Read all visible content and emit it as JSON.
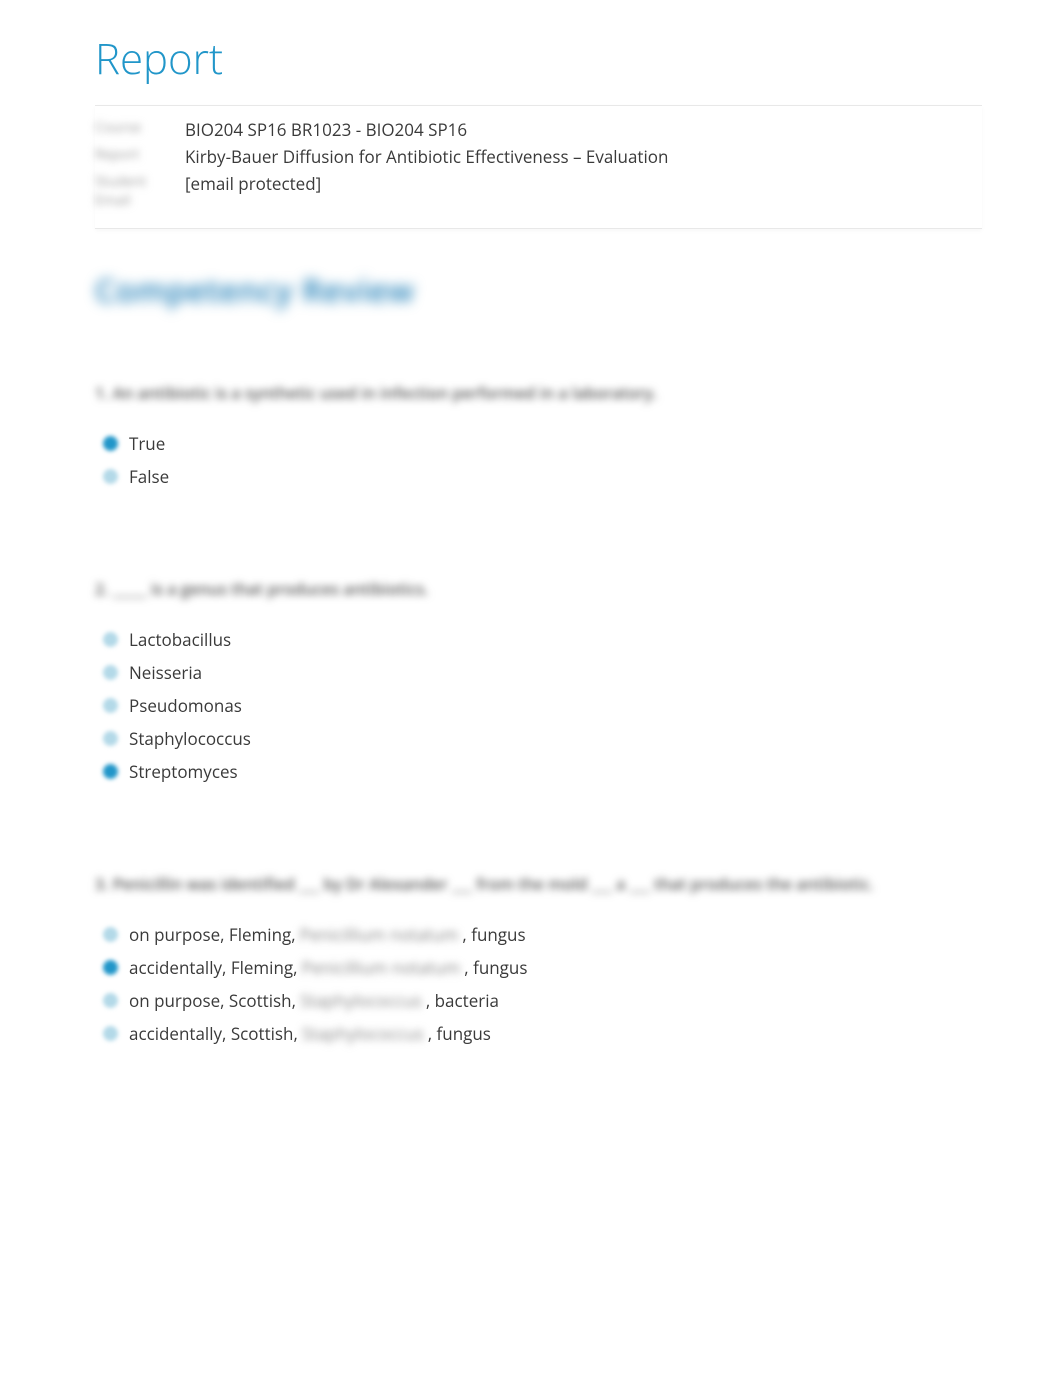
{
  "pageTitle": "Report",
  "header": {
    "labels": {
      "course": "Course",
      "report": "Report",
      "email": "Student Email"
    },
    "course": "BIO204 SP16 BR1023 - BIO204 SP16",
    "report": "Kirby-Bauer Diffusion for Antibiotic Effectiveness – Evaluation",
    "email": "[email protected]"
  },
  "sectionTitle": "Competency Review",
  "questions": [
    {
      "prompt": "1. An antibiotic is a synthetic used in infection performed in a laboratory.",
      "options": [
        {
          "text": "True",
          "selected": true
        },
        {
          "text": "False",
          "selected": false
        }
      ]
    },
    {
      "prompt": "2. _____ is a genus that produces antibiotics.",
      "options": [
        {
          "text": "Lactobacillus",
          "selected": false
        },
        {
          "text": "Neisseria",
          "selected": false
        },
        {
          "text": "Pseudomonas",
          "selected": false
        },
        {
          "text": "Staphylococcus",
          "selected": false
        },
        {
          "text": "Streptomyces",
          "selected": true
        }
      ]
    },
    {
      "prompt": "3. Penicillin was identified ___ by Dr Alexander ___ from the mold ___ a ___ that produces the antibiotic.",
      "options": [
        {
          "parts": [
            "on purpose, Fleming, ",
            "Penicillium notatum",
            " , fungus"
          ],
          "selected": false
        },
        {
          "parts": [
            "accidentally, Fleming, ",
            "Penicillium notatum",
            " , fungus"
          ],
          "selected": true
        },
        {
          "parts": [
            "on purpose, Scottish, ",
            "Staphylococcus",
            " , bacteria"
          ],
          "selected": false
        },
        {
          "parts": [
            "accidentally, Scottish, ",
            "Staphylococcus",
            " , fungus"
          ],
          "selected": false
        }
      ]
    }
  ]
}
